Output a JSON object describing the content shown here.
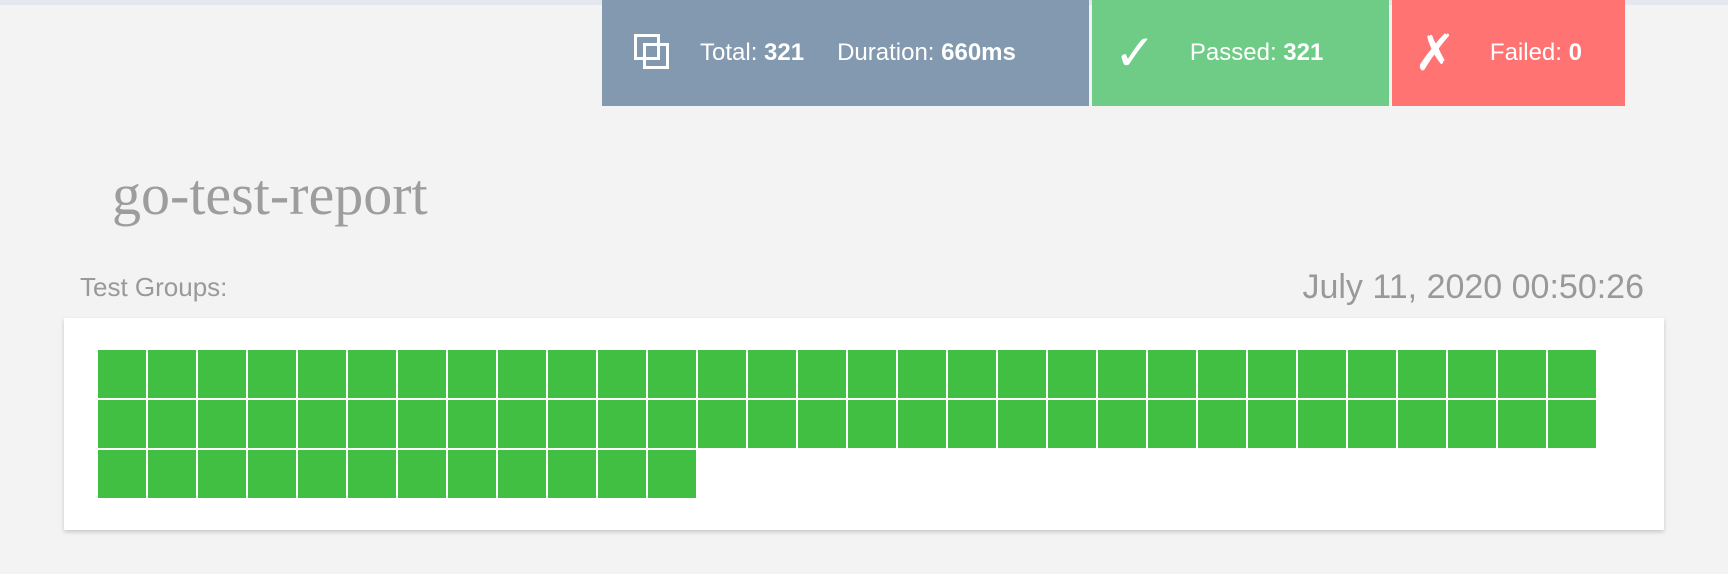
{
  "summary": {
    "total_label": "Total: ",
    "total_value": "321",
    "duration_label": "Duration: ",
    "duration_value": "660ms",
    "passed_glyph": "✓",
    "passed_label": "Passed: ",
    "passed_value": "321",
    "failed_glyph": "✗",
    "failed_label": "Failed: ",
    "failed_value": "0"
  },
  "title": "go-test-report",
  "groups_label": "Test Groups:",
  "timestamp": "July 11, 2020 00:50:26",
  "test_groups": {
    "count": 72,
    "status": "passed",
    "color": "#41bf43"
  },
  "colors": {
    "total": "#8299b0",
    "passed": "#6fcc86",
    "failed": "#ff7373"
  }
}
